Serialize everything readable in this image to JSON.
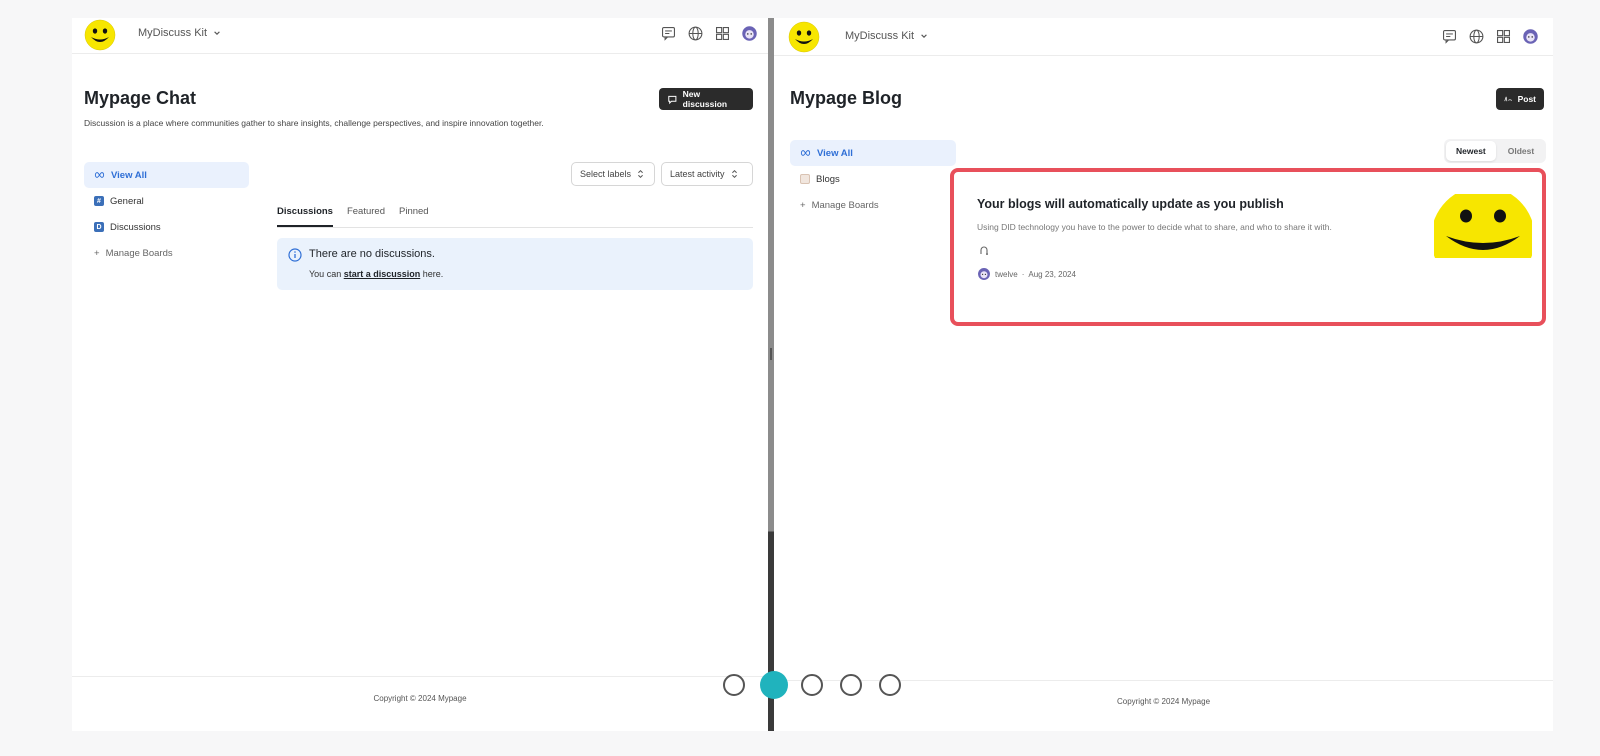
{
  "left": {
    "brand": "MyDiscuss Kit",
    "title": "Mypage Chat",
    "description": "Discussion is a place where communities gather to share insights, challenge perspectives, and inspire innovation together.",
    "new_button": "New discussion",
    "sidebar": [
      {
        "label": "View All"
      },
      {
        "label": "General"
      },
      {
        "label": "Discussions"
      },
      {
        "label": "Manage Boards"
      }
    ],
    "filters": {
      "labels": "Select labels",
      "sort": "Latest activity"
    },
    "tabs": [
      "Discussions",
      "Featured",
      "Pinned"
    ],
    "notice": {
      "title": "There are no discussions.",
      "prefix": "You can",
      "link": "start a discussion",
      "suffix": "here."
    },
    "footer": "Copyright © 2024 Mypage"
  },
  "right": {
    "brand": "MyDiscuss Kit",
    "title": "Mypage Blog",
    "post_button": "Post",
    "sidebar": [
      {
        "label": "View All"
      },
      {
        "label": "Blogs"
      },
      {
        "label": "Manage Boards"
      }
    ],
    "sort": {
      "newest": "Newest",
      "oldest": "Oldest"
    },
    "post": {
      "title": "Your blogs will automatically update as you publish",
      "excerpt": "Using DID technology you have to the power to decide what to share, and who to share it with.",
      "author": "twelve",
      "date": "Aug 23, 2024"
    },
    "footer": "Copyright © 2024 Mypage"
  },
  "colors": {
    "accent": "#2f6fd6",
    "highlight": "#e8505b",
    "pager_active": "#20b3bd",
    "smiley": "#f7e600"
  },
  "pager": {
    "count": 5,
    "active_index": 1
  }
}
